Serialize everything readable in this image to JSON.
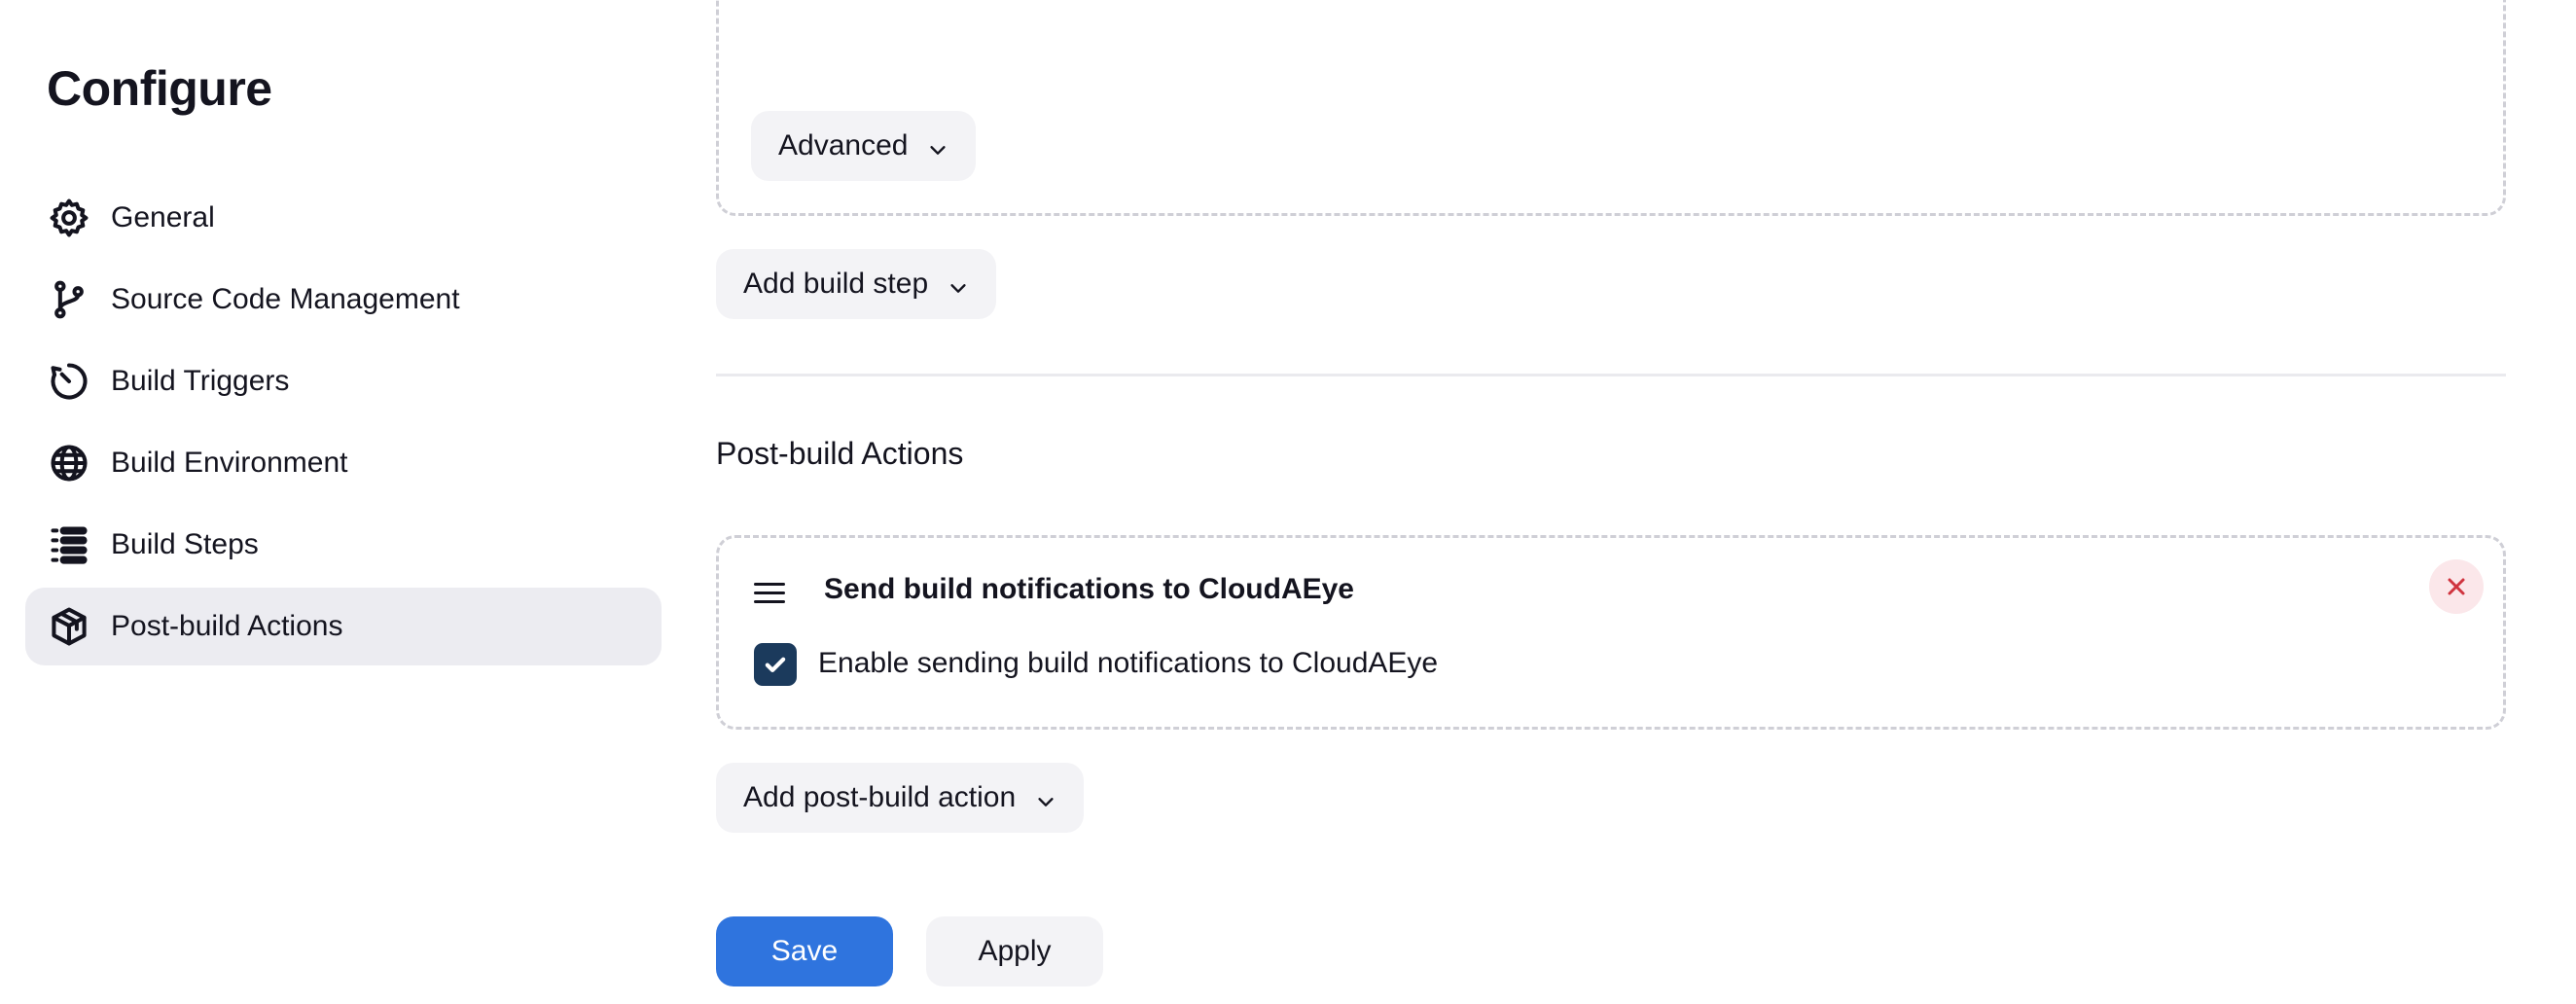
{
  "sidebar": {
    "title": "Configure",
    "items": [
      {
        "label": "General",
        "icon": "gear-icon",
        "active": false
      },
      {
        "label": "Source Code Management",
        "icon": "git-branch-icon",
        "active": false
      },
      {
        "label": "Build Triggers",
        "icon": "clock-icon",
        "active": false
      },
      {
        "label": "Build Environment",
        "icon": "globe-icon",
        "active": false
      },
      {
        "label": "Build Steps",
        "icon": "list-icon",
        "active": false
      },
      {
        "label": "Post-build Actions",
        "icon": "package-icon",
        "active": true
      }
    ]
  },
  "main": {
    "advanced_label": "Advanced",
    "add_build_step_label": "Add build step",
    "post_build_title": "Post-build Actions",
    "post_build_card": {
      "heading": "Send build notifications to CloudAEye",
      "checkbox_label": "Enable sending build notifications to CloudAEye",
      "checkbox_checked": true
    },
    "add_post_build_label": "Add post-build action",
    "save_label": "Save",
    "apply_label": "Apply"
  },
  "colors": {
    "accent": "#2f74de",
    "checkbox": "#1b3a5c",
    "danger": "#d0343f",
    "active_nav_bg": "#ececf1"
  }
}
